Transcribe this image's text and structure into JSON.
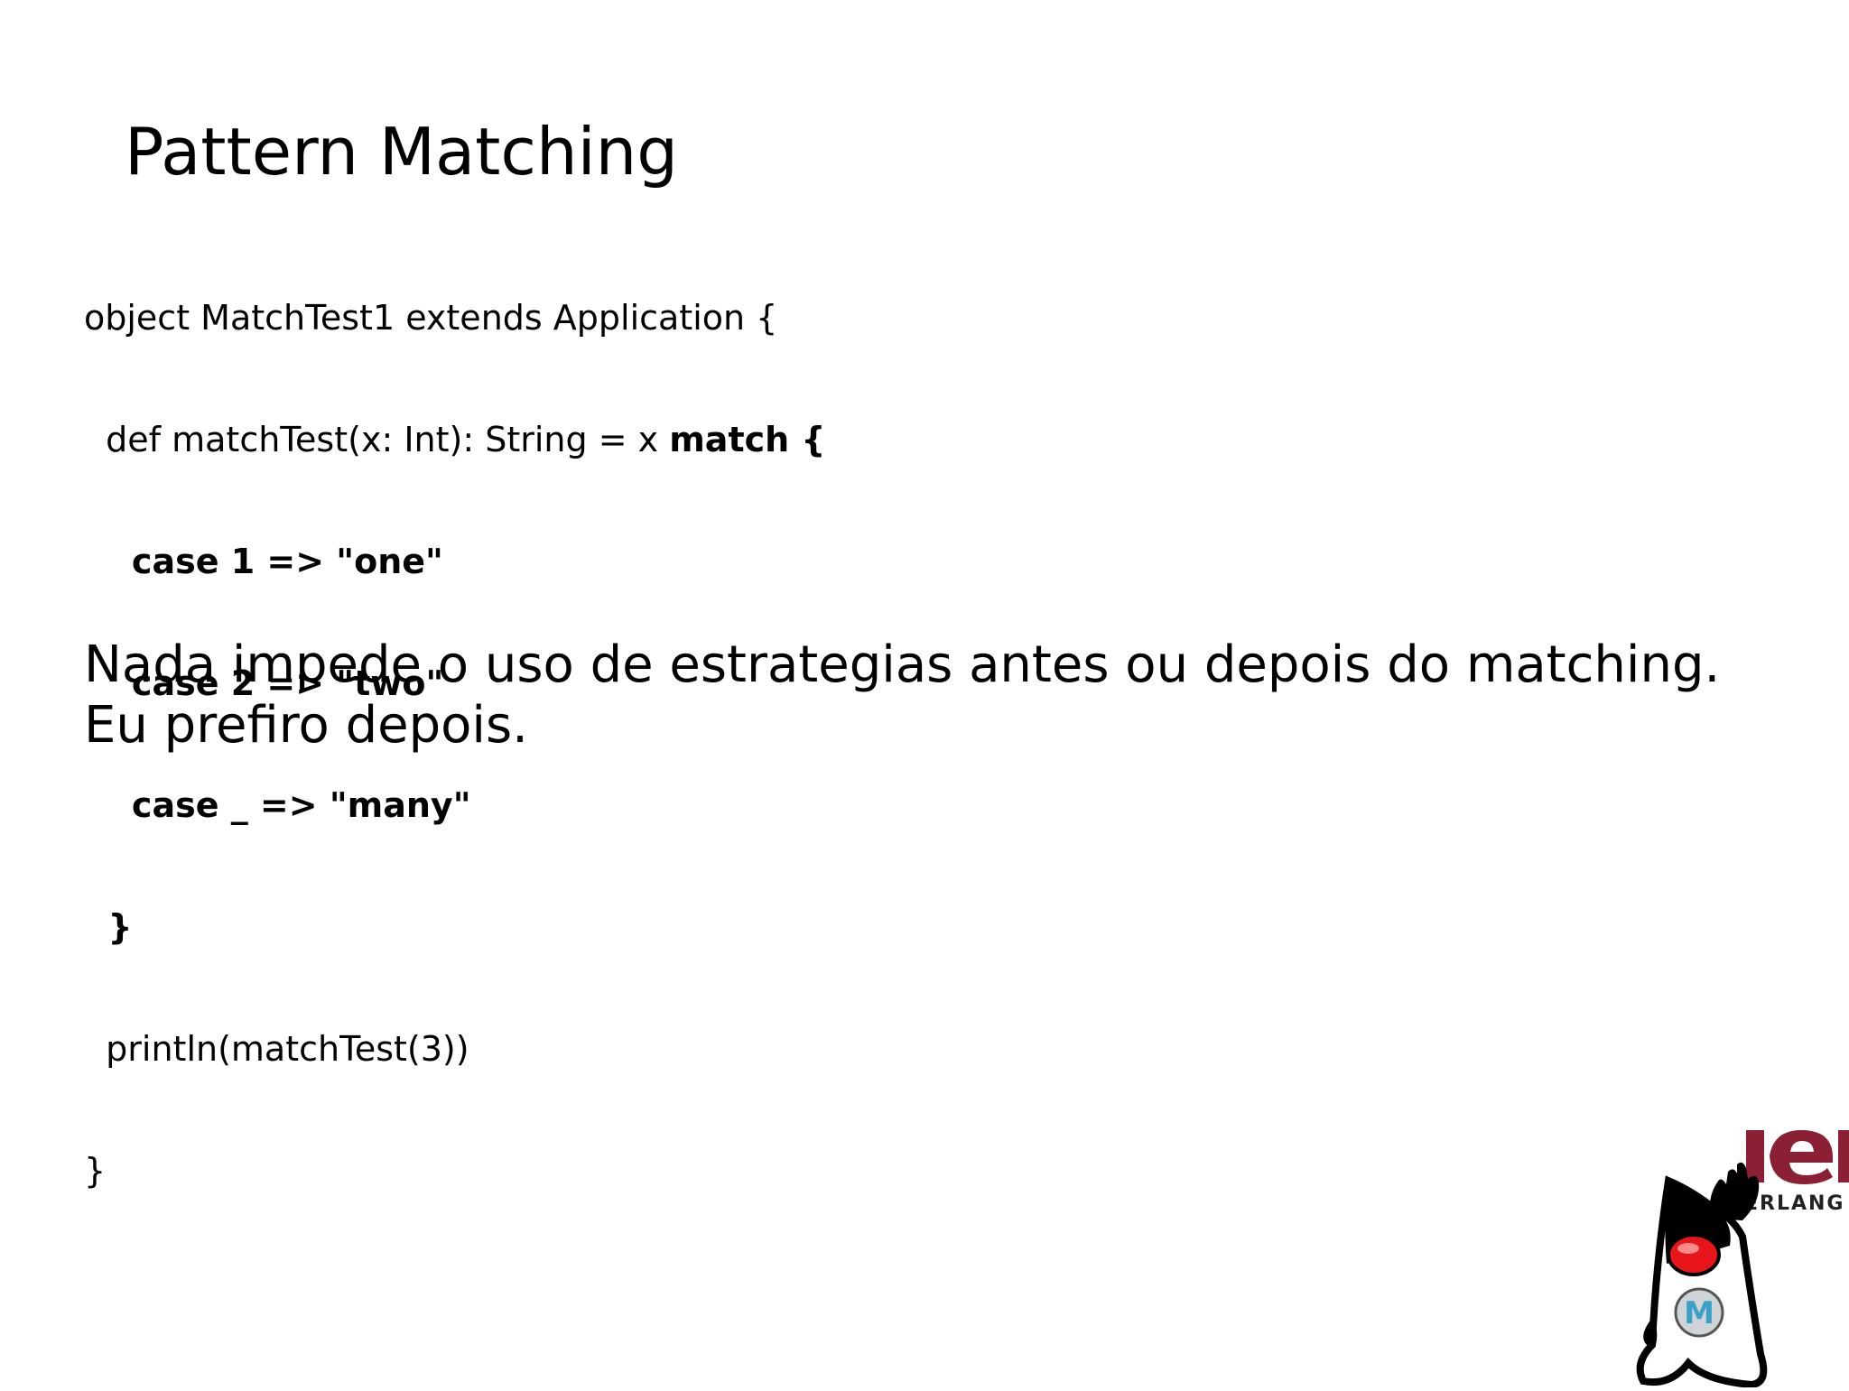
{
  "slide": {
    "title": "Pattern Matching",
    "code": [
      [
        {
          "t": "object MatchTest1 extends Application {",
          "b": false
        }
      ],
      [
        {
          "t": "  def matchTest(x: Int): String = x ",
          "b": false
        },
        {
          "t": "match {",
          "b": true
        }
      ],
      [
        {
          "t": "    case 1 => \"one\"",
          "b": true
        }
      ],
      [
        {
          "t": "    case 2 => \"two\"",
          "b": true
        }
      ],
      [
        {
          "t": "    case _ => \"many\"",
          "b": true
        }
      ],
      [
        {
          "t": "  }",
          "b": true
        }
      ],
      [
        {
          "t": "  println(matchTest(3))",
          "b": false
        }
      ],
      [
        {
          "t": "}",
          "b": false
        }
      ]
    ],
    "body_lines": [
      "Nada impede o uso de estrategias antes ou depois do matching.",
      "Eu prefiro depois."
    ]
  },
  "logo": {
    "text": "ERLANG",
    "icon": "duke-erlang-mascot-icon",
    "colors": {
      "erlang": "#8b2035",
      "nose": "#e8151b",
      "badge": "#3aa0c8"
    }
  }
}
